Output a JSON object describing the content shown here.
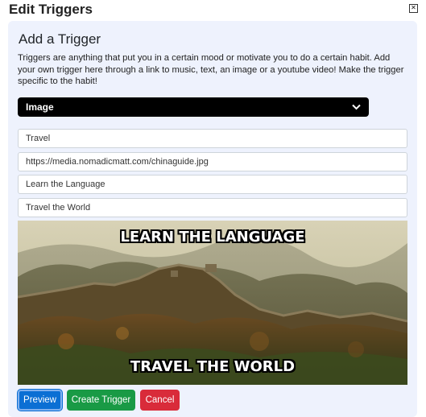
{
  "dialog": {
    "title": "Edit Triggers",
    "close_icon": "close-icon"
  },
  "form": {
    "heading": "Add a Trigger",
    "description": "Triggers are anything that put you in a certain mood or motivate you to do a certain habit. Add your own trigger here through a link to music, text, an image or a youtube video! Make the trigger specific to the habit!",
    "type_select": {
      "selected": "Image",
      "icon": "chevron-down-icon"
    },
    "fields": {
      "name": "Travel",
      "url": "https://media.nomadicmatt.com/chinaguide.jpg",
      "top_text": "Learn the Language",
      "bottom_text": "Travel the World"
    },
    "preview_image": {
      "top_caption": "LEARN THE LANGUAGE",
      "bottom_caption": "TRAVEL THE WORLD"
    }
  },
  "buttons": {
    "preview": "Preview",
    "create": "Create Trigger",
    "cancel": "Cancel"
  },
  "colors": {
    "panel_bg": "#eef2fd",
    "preview_btn": "#0b6fd4",
    "create_btn": "#199a45",
    "cancel_btn": "#d92b3a",
    "select_bg": "#000000"
  }
}
